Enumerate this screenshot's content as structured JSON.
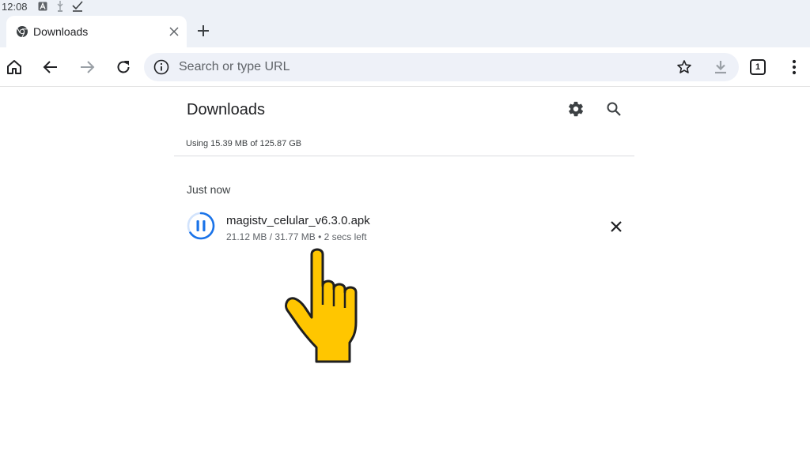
{
  "status_bar": {
    "time": "12:08",
    "icons": [
      "app-a-icon",
      "usb-icon",
      "check-icon"
    ]
  },
  "tab": {
    "title": "Downloads",
    "favicon": "chrome-icon"
  },
  "toolbar": {
    "omnibox_placeholder": "Search or type URL",
    "tab_count": "1"
  },
  "downloads": {
    "title": "Downloads",
    "storage_text": "Using 15.39 MB of 125.87 GB",
    "section_label": "Just now",
    "items": [
      {
        "file_name": "magistv_celular_v6.3.0.apk",
        "meta": "21.12 MB / 31.77 MB • 2 secs left",
        "progress": 0.66,
        "state": "paused-icon"
      }
    ]
  },
  "colors": {
    "accent": "#1a73e8",
    "chrome_bg": "#edf1f7",
    "omnibox_bg": "#eef1f8",
    "hand_fill": "#ffc600"
  }
}
